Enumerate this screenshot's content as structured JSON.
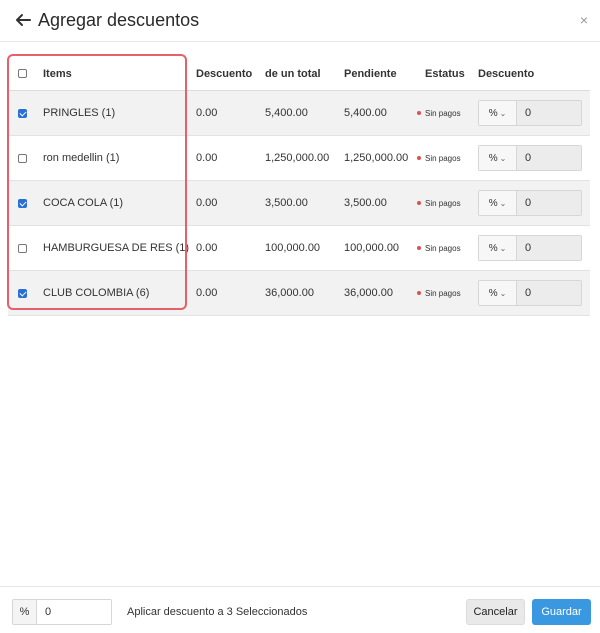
{
  "header": {
    "title": "Agregar descuentos",
    "back_icon": "arrow-left-icon",
    "close_icon": "close-icon",
    "close_glyph": "×"
  },
  "table": {
    "columns": [
      "Items",
      "Descuento",
      "de un total",
      "Pendiente",
      "Estatus",
      "Descuento"
    ],
    "rows": [
      {
        "checked": true,
        "item": "PRINGLES (1)",
        "discount": "0.00",
        "total": "5,400.00",
        "pending": "5,400.00",
        "status": "Sin pagos",
        "type": "%",
        "value": "0"
      },
      {
        "checked": false,
        "item": "ron medellin (1)",
        "discount": "0.00",
        "total": "1,250,000.00",
        "pending": "1,250,000.00",
        "status": "Sin pagos",
        "type": "%",
        "value": "0"
      },
      {
        "checked": true,
        "item": "COCA COLA (1)",
        "discount": "0.00",
        "total": "3,500.00",
        "pending": "3,500.00",
        "status": "Sin pagos",
        "type": "%",
        "value": "0"
      },
      {
        "checked": false,
        "item": "HAMBURGUESA DE RES (1)",
        "discount": "0.00",
        "total": "100,000.00",
        "pending": "100,000.00",
        "status": "Sin pagos",
        "type": "%",
        "value": "0"
      },
      {
        "checked": true,
        "item": "CLUB COLOMBIA (6)",
        "discount": "0.00",
        "total": "36,000.00",
        "pending": "36,000.00",
        "status": "Sin pagos",
        "type": "%",
        "value": "0"
      }
    ]
  },
  "footer": {
    "type": "%",
    "value": "0",
    "apply_text": "Aplicar descuento a 3 Seleccionados",
    "cancel_label": "Cancelar",
    "save_label": "Guardar"
  },
  "colors": {
    "accent": "#3a98e0",
    "checkbox": "#2a6fd6",
    "status_dot": "#d9534f",
    "highlight": "#e5606a"
  }
}
